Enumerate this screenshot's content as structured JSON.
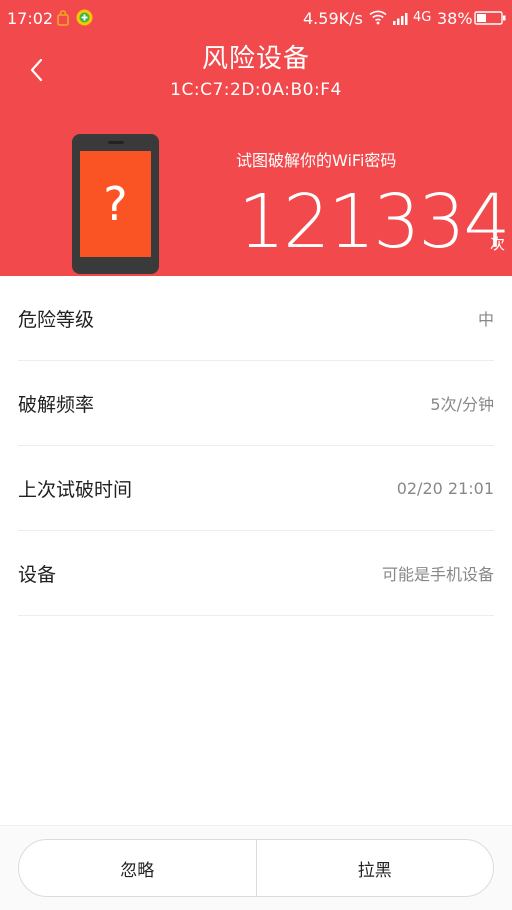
{
  "status_bar": {
    "time": "17:02",
    "net_speed": "4.59K/s",
    "network": "4G",
    "battery": "38%"
  },
  "header": {
    "title": "风险设备",
    "mac": "1C:C7:2D:0A:B0:F4",
    "phone_symbol": "?",
    "attempt_label": "试图破解你的WiFi密码",
    "attempt_count": "121334",
    "attempt_unit": "次",
    "bg_color": "#f2494d"
  },
  "info": [
    {
      "label": "危险等级",
      "value": "中"
    },
    {
      "label": "破解频率",
      "value": "5次/分钟"
    },
    {
      "label": "上次试破时间",
      "value": "02/20 21:01"
    },
    {
      "label": "设备",
      "value": "可能是手机设备"
    }
  ],
  "actions": {
    "ignore_label": "忽略",
    "block_label": "拉黑"
  },
  "icons": {
    "back": "back-arrow-icon",
    "wifi": "wifi-icon",
    "signal": "signal-icon",
    "battery": "battery-icon"
  }
}
